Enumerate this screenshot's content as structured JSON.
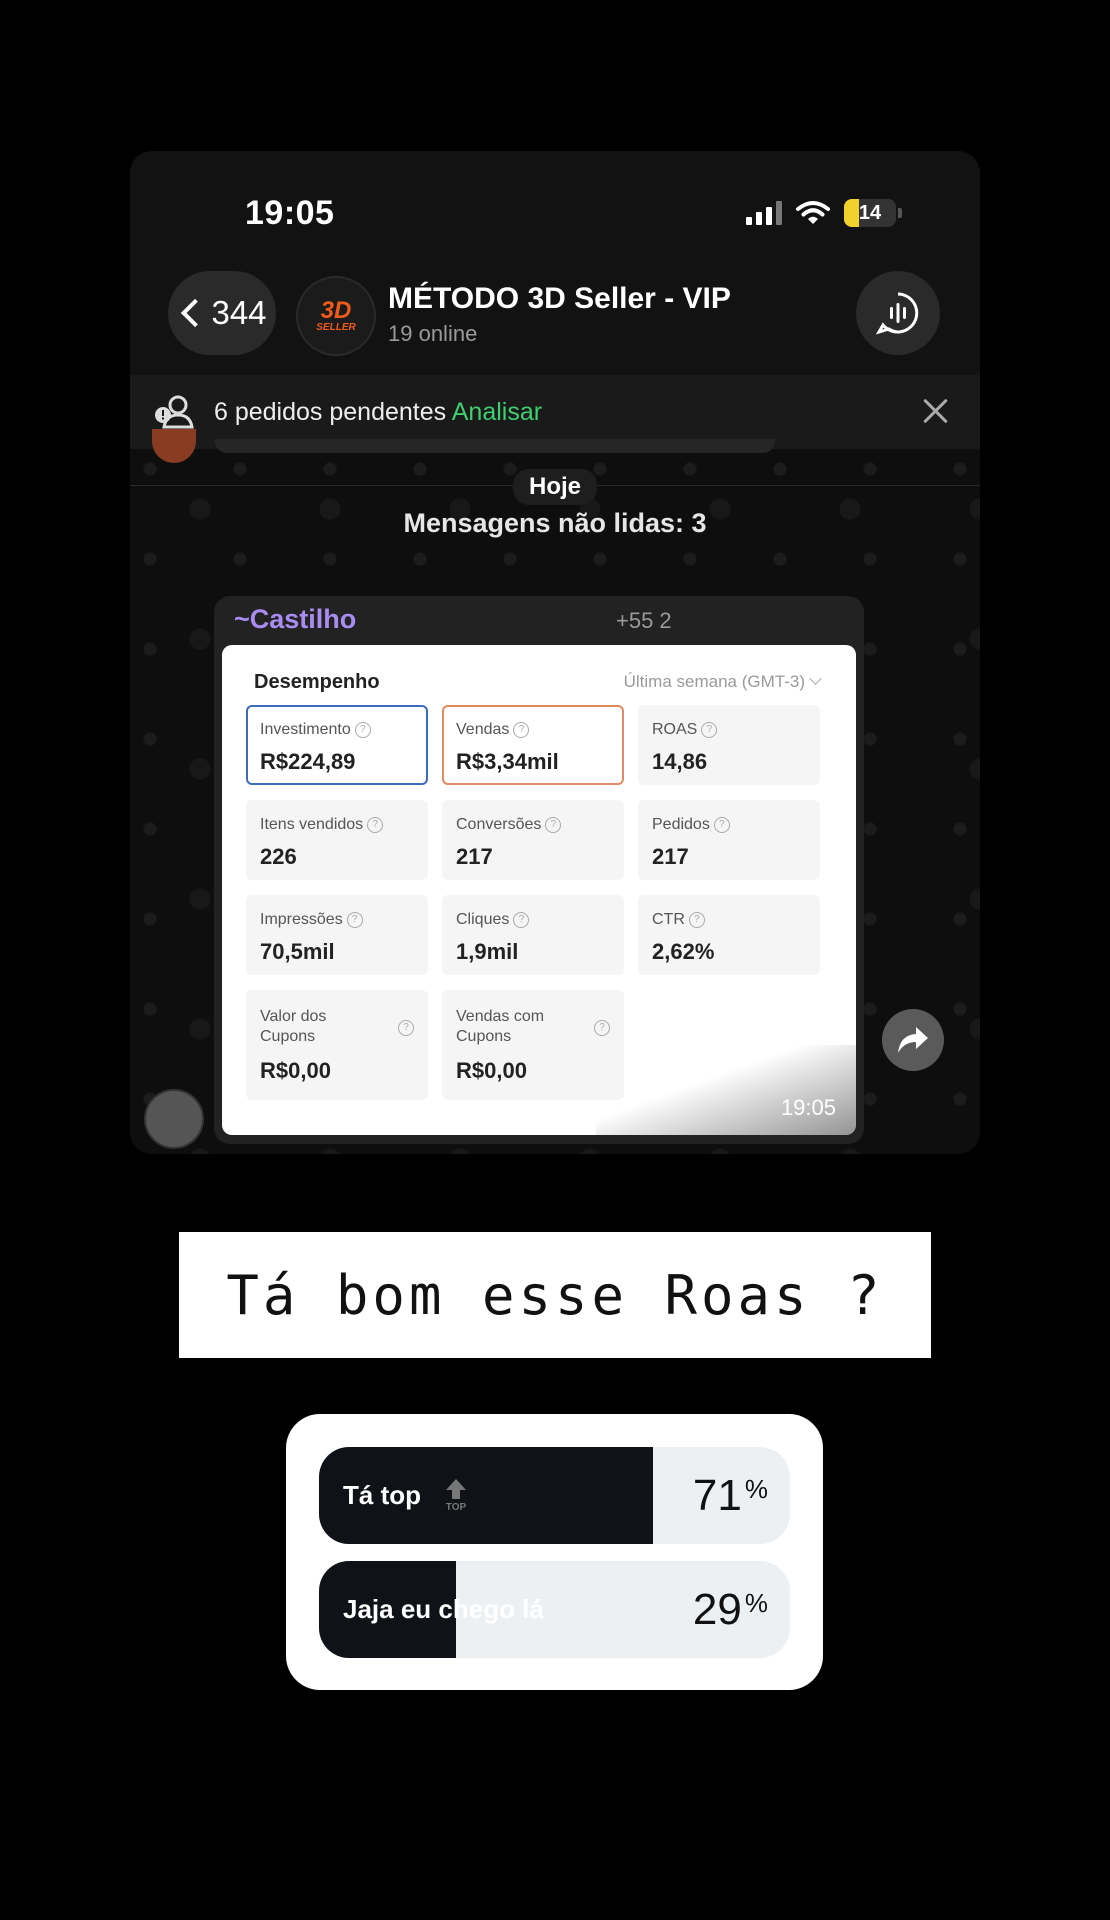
{
  "status_bar": {
    "time": "19:05",
    "battery": "14"
  },
  "chat_header": {
    "back_count": "344",
    "group_name": "MÉTODO 3D Seller - VIP",
    "online": "19 online",
    "avatar_text": "3D",
    "avatar_sub": "SELLER"
  },
  "pending": {
    "text": "6 pedidos pendentes",
    "action": "Analisar"
  },
  "chat": {
    "day": "Hoje",
    "unread": "Mensagens não lidas: 3",
    "message": {
      "sender": "~Castilho",
      "phone": "+55 2",
      "time": "19:05",
      "card": {
        "title": "Desempenho",
        "period": "Última semana (GMT-3)",
        "metrics": [
          {
            "label": "Investimento",
            "value": "R$224,89"
          },
          {
            "label": "Vendas",
            "value": "R$3,34mil"
          },
          {
            "label": "ROAS",
            "value": "14,86"
          },
          {
            "label": "Itens vendidos",
            "value": "226"
          },
          {
            "label": "Conversões",
            "value": "217"
          },
          {
            "label": "Pedidos",
            "value": "217"
          },
          {
            "label": "Impressões",
            "value": "70,5mil"
          },
          {
            "label": "Cliques",
            "value": "1,9mil"
          },
          {
            "label": "CTR",
            "value": "2,62%"
          },
          {
            "label": "Valor dos Cupons",
            "value": "R$0,00"
          },
          {
            "label": "Vendas com Cupons",
            "value": "R$0,00"
          }
        ]
      }
    }
  },
  "question": "Tá bom esse Roas ?",
  "poll": {
    "options": [
      {
        "label": "Tá top",
        "percent": "71",
        "fraction": 0.71,
        "icon_text": "TOP"
      },
      {
        "label": "Jaja eu chego lá",
        "percent": "29",
        "fraction": 0.29
      }
    ],
    "percent_sign": "%"
  }
}
